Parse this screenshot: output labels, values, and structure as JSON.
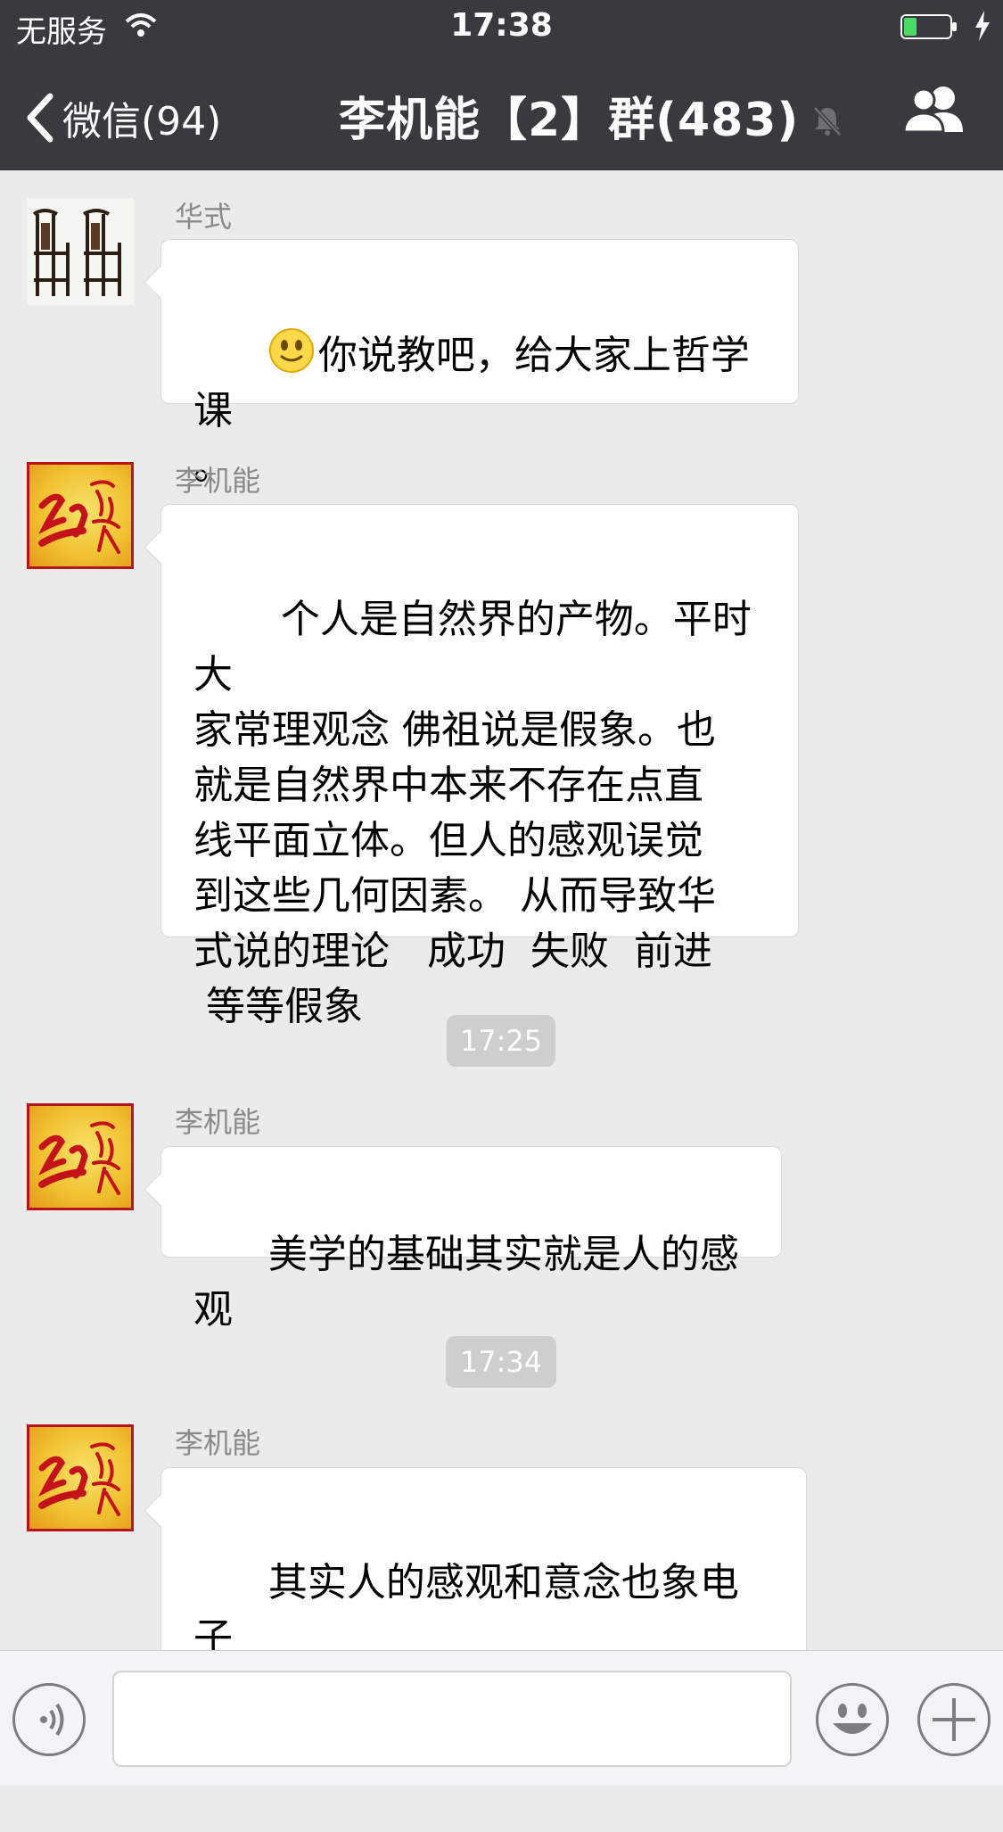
{
  "status_bar": {
    "carrier": "无服务",
    "time": "17:38",
    "battery_color": "#4cd964"
  },
  "nav": {
    "back_label": "微信(94)",
    "title": "李机能【2】群(483)",
    "icons": [
      "chevron-left-icon",
      "mute-bell-icon",
      "group-members-icon"
    ]
  },
  "messages": [
    {
      "sender": "华式",
      "avatar": "chairs",
      "emoji": "smiley-emoji",
      "text": "你说教吧，给大家上哲学课\n。"
    },
    {
      "sender": "李机能",
      "avatar": "red-calligraphy",
      "text": " 个人是自然界的产物。平时大\n家常理观念 佛祖说是假象。也\n就是自然界中本来不存在点直\n线平面立体。但人的感观误觉\n到这些几何因素。 从而导致华\n式说的理论   成功  失败  前进\n 等等假象"
    },
    {
      "time": "17:25"
    },
    {
      "sender": "李机能",
      "avatar": "red-calligraphy",
      "text": "美学的基础其实就是人的感观"
    },
    {
      "time": "17:34"
    },
    {
      "sender": "李机能",
      "avatar": "red-calligraphy",
      "text": "其实人的感观和意念也象电子\n云一样 是千变万化漫无目的 另\n外一面 同时也被原子核严格控"
    }
  ],
  "input_bar": {
    "text_value": "",
    "icons": [
      "voice-icon",
      "emoji-icon",
      "plus-icon"
    ]
  },
  "colors": {
    "header_bg": "#393a3f",
    "chat_bg": "#ebebeb",
    "bubble_bg": "#ffffff",
    "avatar_red": "#b8141b"
  }
}
